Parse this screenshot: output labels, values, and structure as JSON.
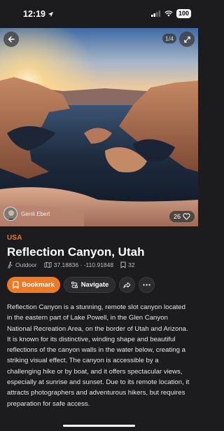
{
  "status_bar": {
    "time": "12:19",
    "battery": "100"
  },
  "hero": {
    "page_indicator": "1/4",
    "author_name": "Gerrit Ebert",
    "likes_count": "26"
  },
  "place": {
    "region": "USA",
    "title": "Reflection Canyon, Utah",
    "category": "Outdoor",
    "coordinates": "37.18836 · -110.91848",
    "bookmark_count": "32"
  },
  "actions": {
    "bookmark_label": "Bookmark",
    "navigate_label": "Navigate"
  },
  "description": "Reflection Canyon is a stunning, remote slot canyon located in the eastern part of Lake Powell, in the Glen Canyon National Recreation Area, on the border of Utah and Arizona. It is known for its distinctive, winding shape and beautiful reflections of the canyon walls in the water below, creating a striking visual effect. The canyon is accessible by a challenging hike or by boat, and it offers spectacular views, especially at sunrise and sunset. Due to its remote location, it attracts photographers and adventurous hikers, but requires preparation for safe access.",
  "colors": {
    "accent": "#f07a23",
    "background": "#1c1c1e"
  }
}
